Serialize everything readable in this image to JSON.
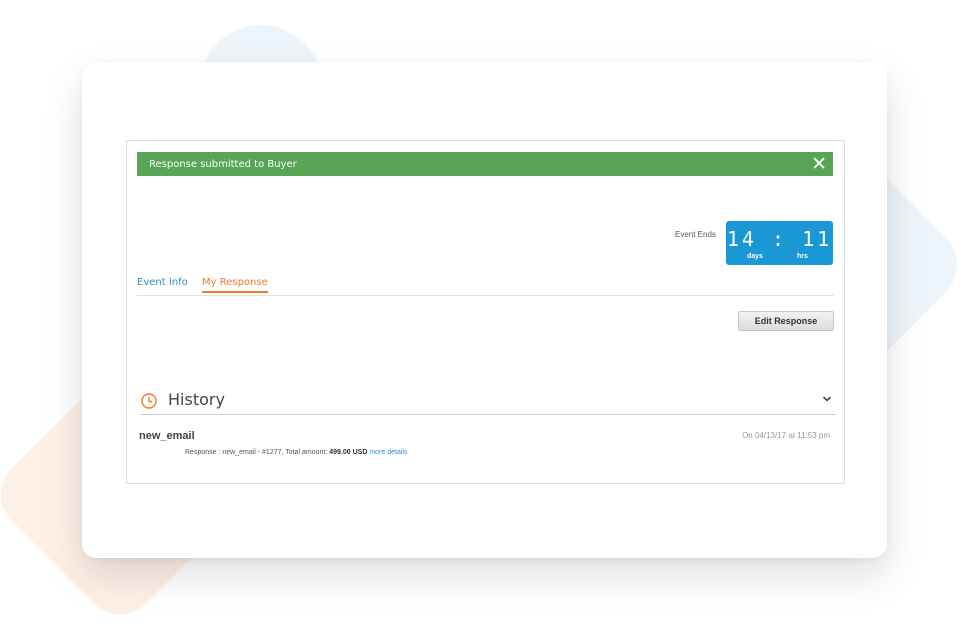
{
  "alert": {
    "message": "Response submitted to Buyer",
    "close_glyph": "✕"
  },
  "event": {
    "ends_label": "Event Ends",
    "countdown": {
      "days": "14",
      "separator": ":",
      "hours": "11",
      "days_label": "days",
      "hours_label": "hrs"
    }
  },
  "tabs": [
    {
      "label": "Event Info",
      "active": false
    },
    {
      "label": "My Response",
      "active": true
    }
  ],
  "actions": {
    "edit_response": "Edit Response"
  },
  "history": {
    "title": "History",
    "entries": [
      {
        "name": "new_email",
        "date": "On 04/13/17 at 11:53 pm",
        "detail_prefix": "Response : new_email - #1277, Total amount: ",
        "amount": "499.00 USD",
        "link": "more details"
      }
    ]
  },
  "colors": {
    "success": "#58a655",
    "accent_orange": "#f07a2a",
    "link_blue": "#2a8fd1",
    "countdown_blue": "#1a98d6"
  }
}
